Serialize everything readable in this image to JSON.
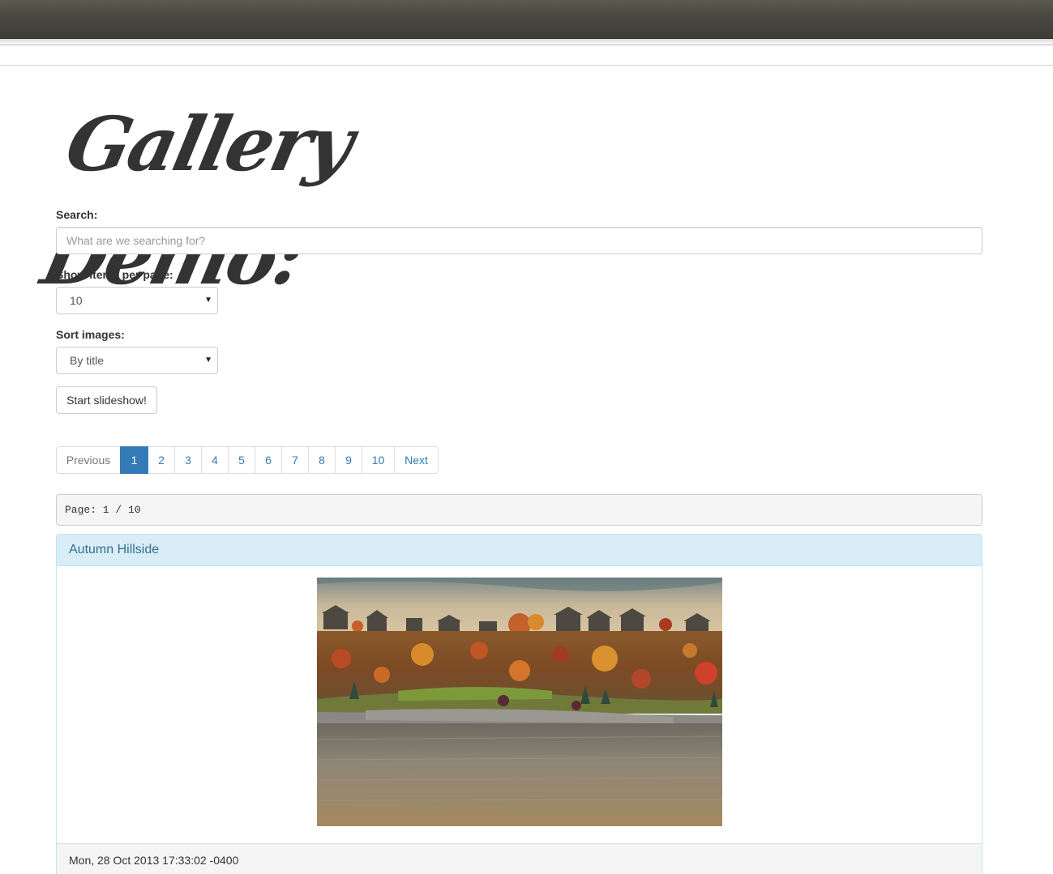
{
  "header": {
    "title": "Gallery Demo:"
  },
  "search": {
    "label": "Search:",
    "placeholder": "What are we searching for?",
    "value": ""
  },
  "items_per_page": {
    "label": "Show items per page:",
    "selected": "10"
  },
  "sort": {
    "label": "Sort images:",
    "selected": "By title"
  },
  "slideshow": {
    "label": "Start slideshow!"
  },
  "pagination": {
    "previous": "Previous",
    "pages": [
      "1",
      "2",
      "3",
      "4",
      "5",
      "6",
      "7",
      "8",
      "9",
      "10"
    ],
    "next": "Next",
    "active_page": "1"
  },
  "page_indicator": {
    "text": "Page: 1 / 10"
  },
  "gallery_item": {
    "title": "Autumn Hillside",
    "date": "Mon, 28 Oct 2013 17:33:02 -0400"
  },
  "colors": {
    "topbar": "#4a4840",
    "primary": "#337ab7",
    "panel_heading_bg": "#d9edf7",
    "panel_heading_text": "#31708f"
  }
}
